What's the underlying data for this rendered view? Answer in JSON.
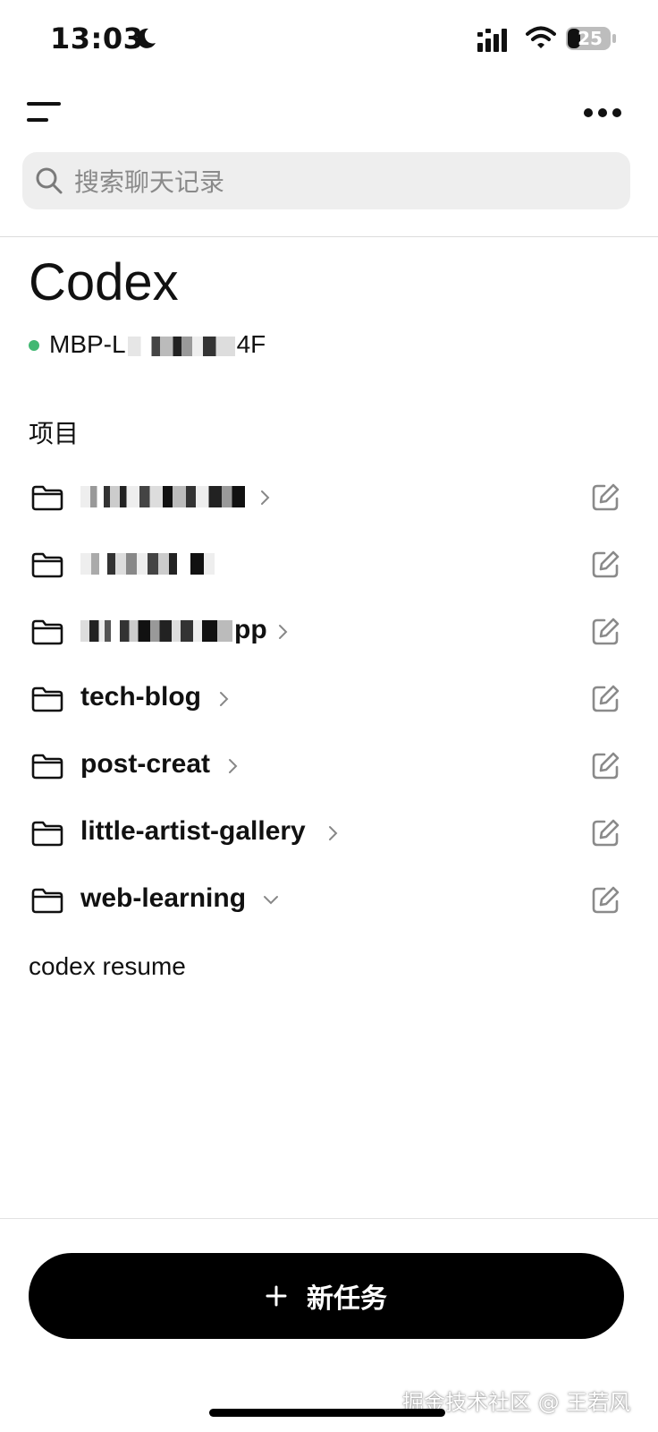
{
  "status_bar": {
    "time": "13:03",
    "battery": "25"
  },
  "search": {
    "placeholder": "搜索聊天记录"
  },
  "header": {
    "title": "Codex",
    "device_name": "MBP-L",
    "device_suffix": "4F",
    "online_color": "#41b872"
  },
  "projects": {
    "heading": "项目",
    "items": [
      {
        "label": "",
        "redacted": true,
        "expanded": false
      },
      {
        "label": "",
        "redacted": true,
        "expanded": false
      },
      {
        "label": "pp",
        "redacted": true,
        "expanded": false
      },
      {
        "label": "tech-blog",
        "redacted": false,
        "expanded": false
      },
      {
        "label": "post-creat",
        "redacted": false,
        "expanded": false
      },
      {
        "label": "little-artist-gallery",
        "redacted": false,
        "expanded": false
      },
      {
        "label": "web-learning",
        "redacted": false,
        "expanded": true
      }
    ]
  },
  "command": {
    "text": "codex resume"
  },
  "footer": {
    "new_task_label": "新任务"
  },
  "watermark": {
    "text": "掘金技术社区 @ 王若风"
  }
}
